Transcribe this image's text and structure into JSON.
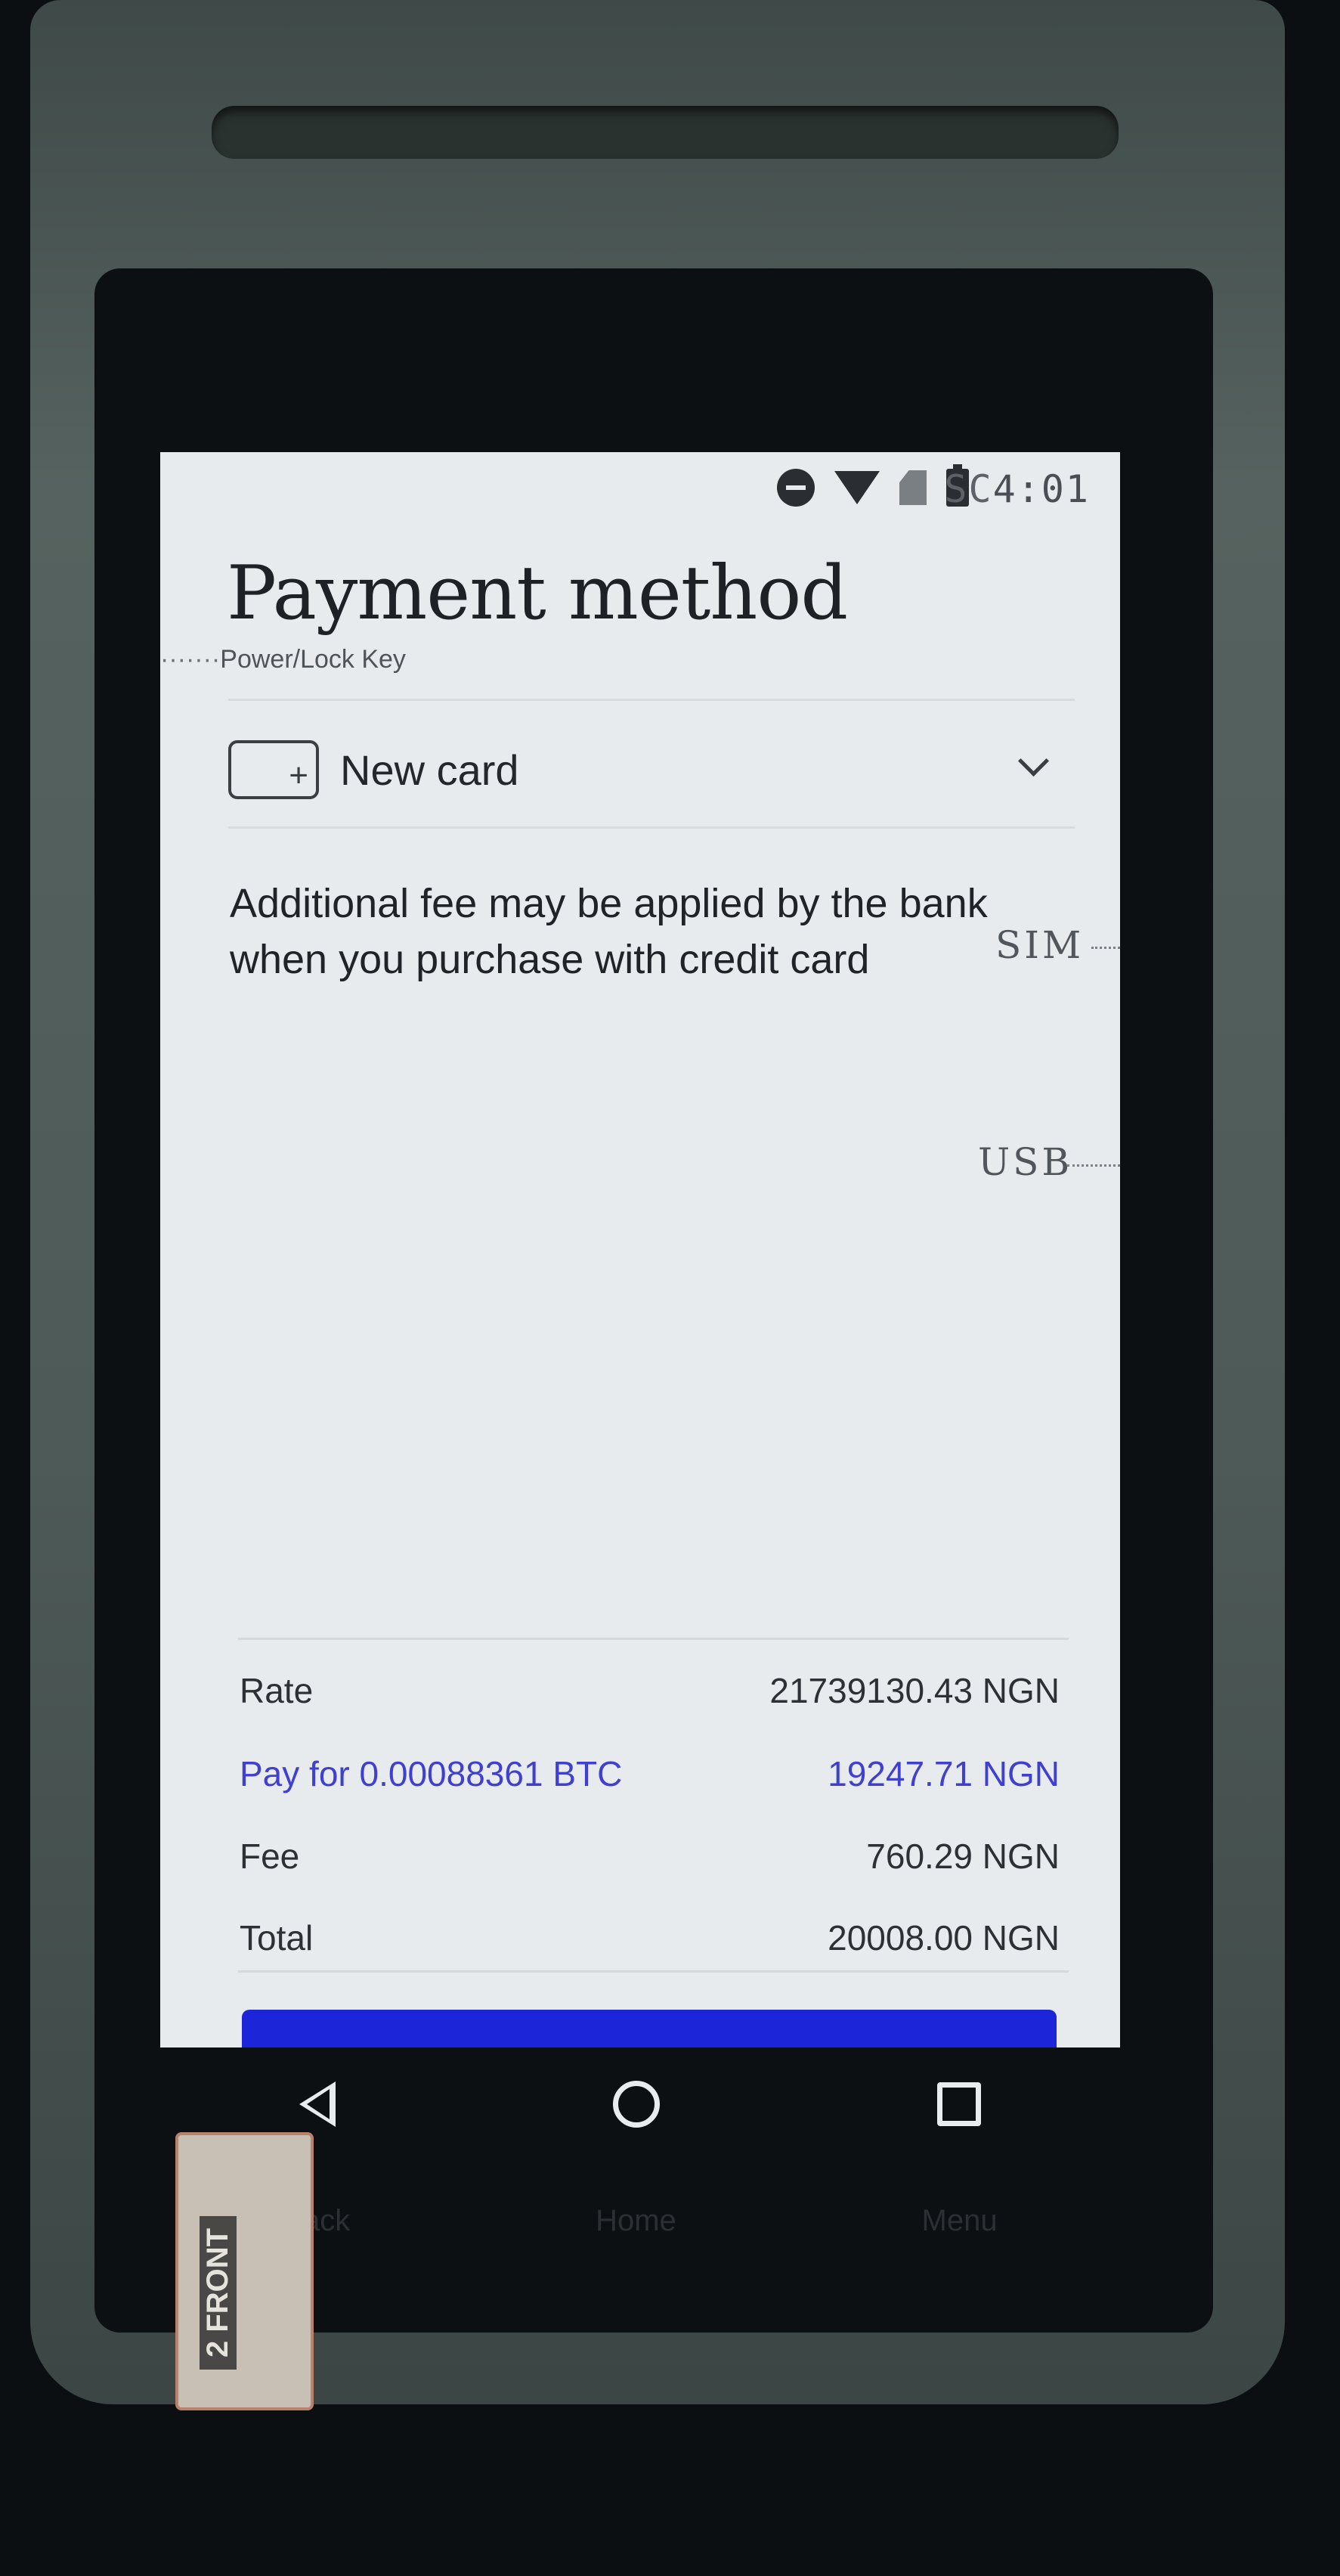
{
  "status_bar": {
    "clock": "4:01",
    "clock_overlay_label": "SC",
    "icons": [
      "do-not-disturb-icon",
      "wifi-icon",
      "no-sim-icon",
      "battery-icon"
    ]
  },
  "page": {
    "title": "Payment method"
  },
  "hardware_callouts": {
    "power_lock": "Power/Lock Key",
    "sim": "SIM",
    "usb": "USB"
  },
  "payment_selector": {
    "label": "New card",
    "icon": "add-card-icon"
  },
  "notice": {
    "text": "Additional fee may be applied by the bank when you purchase with credit card"
  },
  "summary": {
    "rows": [
      {
        "label": "Rate",
        "value": "21739130.43 NGN",
        "highlight": false
      },
      {
        "label": "Pay for 0.00088361 BTC",
        "value": "19247.71 NGN",
        "highlight": true
      },
      {
        "label": "Fee",
        "value": "760.29 NGN",
        "highlight": false
      },
      {
        "label": "Total",
        "value": "20008.00 NGN",
        "highlight": false
      }
    ]
  },
  "nav_bar": {
    "items": [
      "back-icon",
      "home-icon",
      "recents-icon"
    ]
  },
  "hardware_keys": {
    "back": "Back",
    "home": "Home",
    "menu": "Menu"
  },
  "sticker": {
    "text": "2 FRONT"
  },
  "colors": {
    "accent_blue": "#3f3fd0",
    "button_blue": "#1c26d8",
    "screen_bg": "#e7ebee"
  }
}
